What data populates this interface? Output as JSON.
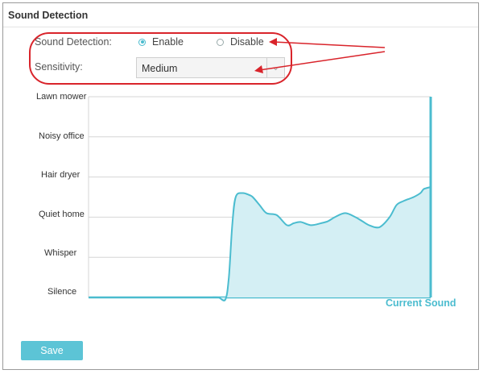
{
  "header": {
    "title": "Sound Detection"
  },
  "form": {
    "detection_label": "Sound Detection:",
    "enable_label": "Enable",
    "disable_label": "Disable",
    "selected": "enable",
    "sensitivity_label": "Sensitivity:",
    "sensitivity_value": "Medium"
  },
  "chart_data": {
    "type": "area",
    "title": "",
    "ylabel": "",
    "categories": [
      "Silence",
      "Whisper",
      "Quiet home",
      "Hair dryer",
      "Noisy office",
      "Lawn mower"
    ],
    "ylim": [
      0,
      5
    ],
    "x": [
      0,
      5,
      10,
      15,
      20,
      25,
      30,
      35,
      36,
      38,
      40,
      41,
      42,
      43,
      45,
      47,
      48,
      50,
      52,
      55,
      58,
      60,
      62,
      65,
      68,
      70,
      72,
      75,
      78,
      80,
      82,
      85,
      88,
      90,
      92,
      95,
      97,
      98,
      100
    ],
    "series": [
      {
        "values": [
          0,
          0,
          0,
          0,
          0,
          0,
          0,
          0,
          0,
          0,
          -0.05,
          0.5,
          1.8,
          2.5,
          2.6,
          2.55,
          2.5,
          2.3,
          2.1,
          2.05,
          1.8,
          1.85,
          1.88,
          1.8,
          1.85,
          1.9,
          2.0,
          2.1,
          2.0,
          1.9,
          1.8,
          1.75,
          2.0,
          2.3,
          2.4,
          2.5,
          2.6,
          2.7,
          2.75
        ]
      }
    ],
    "current_label": "Current Sound",
    "grid": true,
    "colors": {
      "line": "#4bbccf",
      "fill": "#d4eff4"
    }
  },
  "actions": {
    "save_label": "Save"
  },
  "annotations": {
    "color": "#d9242b"
  }
}
